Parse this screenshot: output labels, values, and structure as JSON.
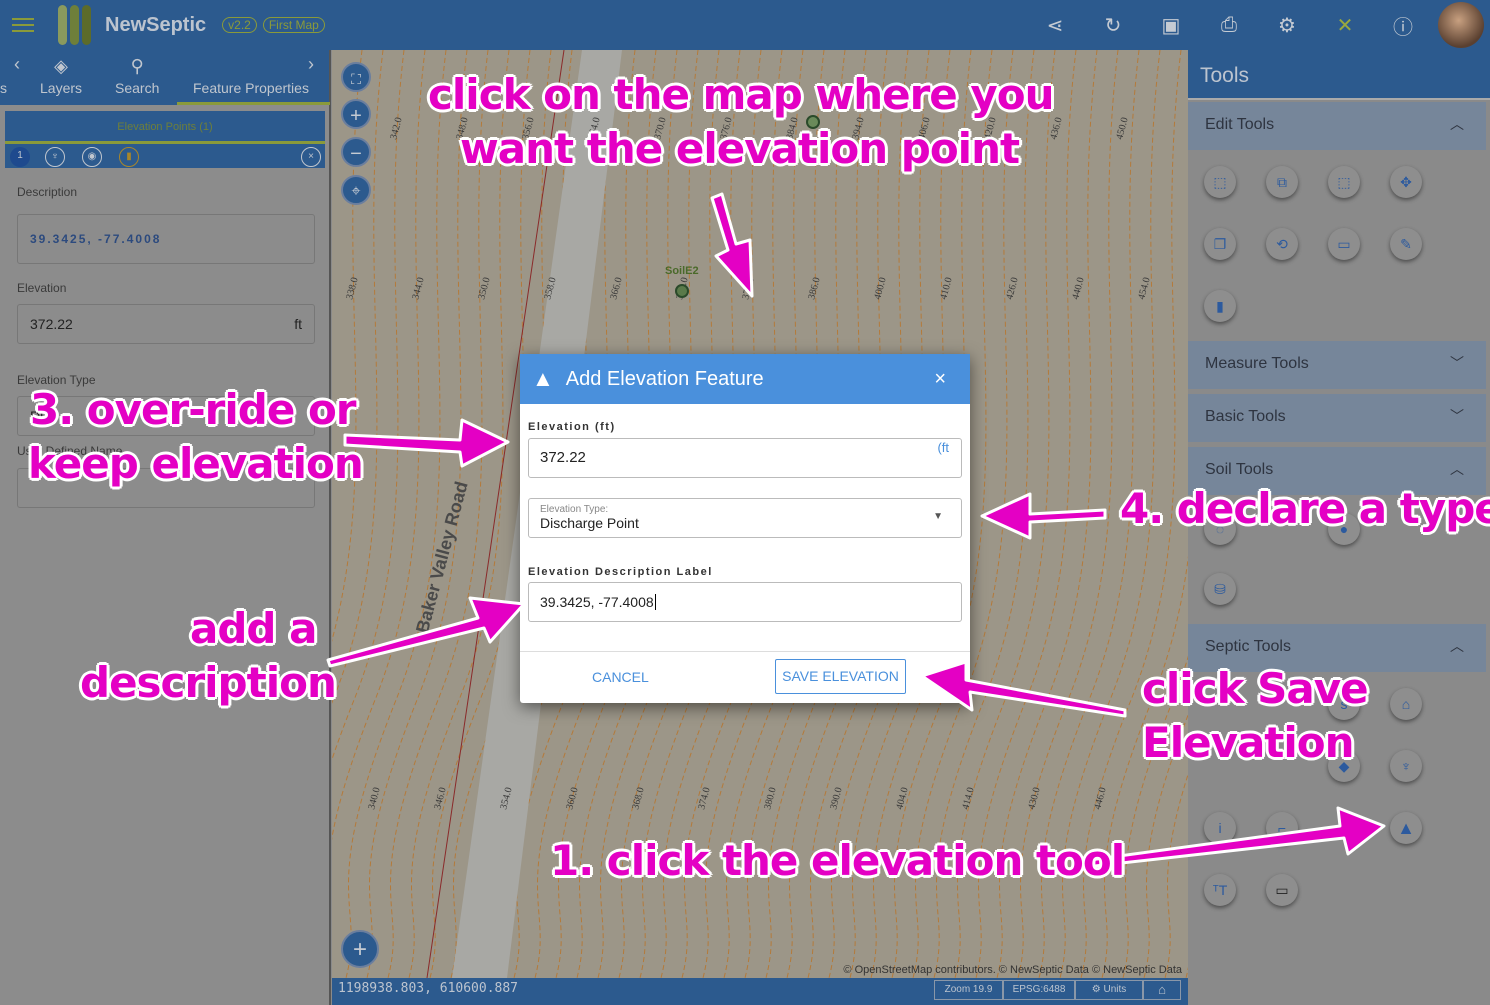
{
  "header": {
    "app_name": "NewSeptic",
    "version": "v2.2",
    "map_name": "First Map",
    "icons": [
      "share-icon",
      "refresh-icon",
      "save-icon",
      "print-icon",
      "settings-icon",
      "tools-icon",
      "info-icon"
    ]
  },
  "left_panel": {
    "tabs": [
      {
        "label": "s"
      },
      {
        "label": "Layers",
        "icon": "layers-icon"
      },
      {
        "label": "Search",
        "icon": "search-icon"
      },
      {
        "label": "Feature Properties",
        "active": true
      }
    ],
    "group_title": "Elevation Points (1)",
    "group_count": "1",
    "description_label": "Description",
    "description_value": "39.3425, -77.4008",
    "elevation_label": "Elevation",
    "elevation_value": "372.22",
    "elevation_unit": "ft",
    "elevation_type_label": "Elevation Type",
    "elevation_type_value": "Di",
    "user_name_label": "User Defined Name"
  },
  "map": {
    "coordinates": "1198938.803, 610600.887",
    "zoom": "Zoom 19.9",
    "epsg": "EPSG:6488",
    "units_label": "Units",
    "attribution": "© OpenStreetMap contributors. © NewSeptic Data © NewSeptic Data",
    "marker_label": "SoilE2",
    "road_label": "Baker Valley Road",
    "contour_labels": [
      "338.0",
      "340.0",
      "342.0",
      "344.0",
      "346.0",
      "348.0",
      "350.0",
      "354.0",
      "356.0",
      "358.0",
      "360.0",
      "364.0",
      "366.0",
      "368.0",
      "370.0",
      "372.0",
      "374.0",
      "376.0",
      "378.0",
      "380.0",
      "384.0",
      "386.0",
      "390.0",
      "394.0",
      "400.0",
      "404.0",
      "406.0",
      "410.0",
      "414.0",
      "420.0",
      "426.0",
      "430.0",
      "436.0",
      "440.0",
      "446.0",
      "450.0",
      "454.0"
    ]
  },
  "dialog": {
    "title": "Add Elevation Feature",
    "elevation_label": "Elevation (ft)",
    "elevation_value": "372.22",
    "elevation_suffix": "(ft",
    "type_label": "Elevation Type:",
    "type_value": "Discharge Point",
    "description_label": "Elevation Description Label",
    "description_value": "39.3425, -77.4008",
    "cancel": "CANCEL",
    "save": "SAVE ELEVATION"
  },
  "right_panel": {
    "title": "Tools",
    "sections": [
      {
        "label": "Edit Tools",
        "expanded": true
      },
      {
        "label": "Measure Tools",
        "expanded": false
      },
      {
        "label": "Basic Tools",
        "expanded": false
      },
      {
        "label": "Soil Tools",
        "expanded": true
      },
      {
        "label": "Septic Tools",
        "expanded": true
      }
    ]
  },
  "annotations": {
    "a1": "click on the map where you",
    "a2": "want the elevation point",
    "a3a": "3. over-ride or",
    "a3b": "keep elevation",
    "a4": "4. declare a type",
    "a5a": "add a",
    "a5b": "description",
    "a6a": "click Save",
    "a6b": "Elevation",
    "a7": "1. click the elevation tool"
  },
  "colors": {
    "header": "#2c5a8e",
    "dialog_header": "#4a90dc",
    "accent": "#8a9a3a",
    "annotation": "#e400c4"
  }
}
